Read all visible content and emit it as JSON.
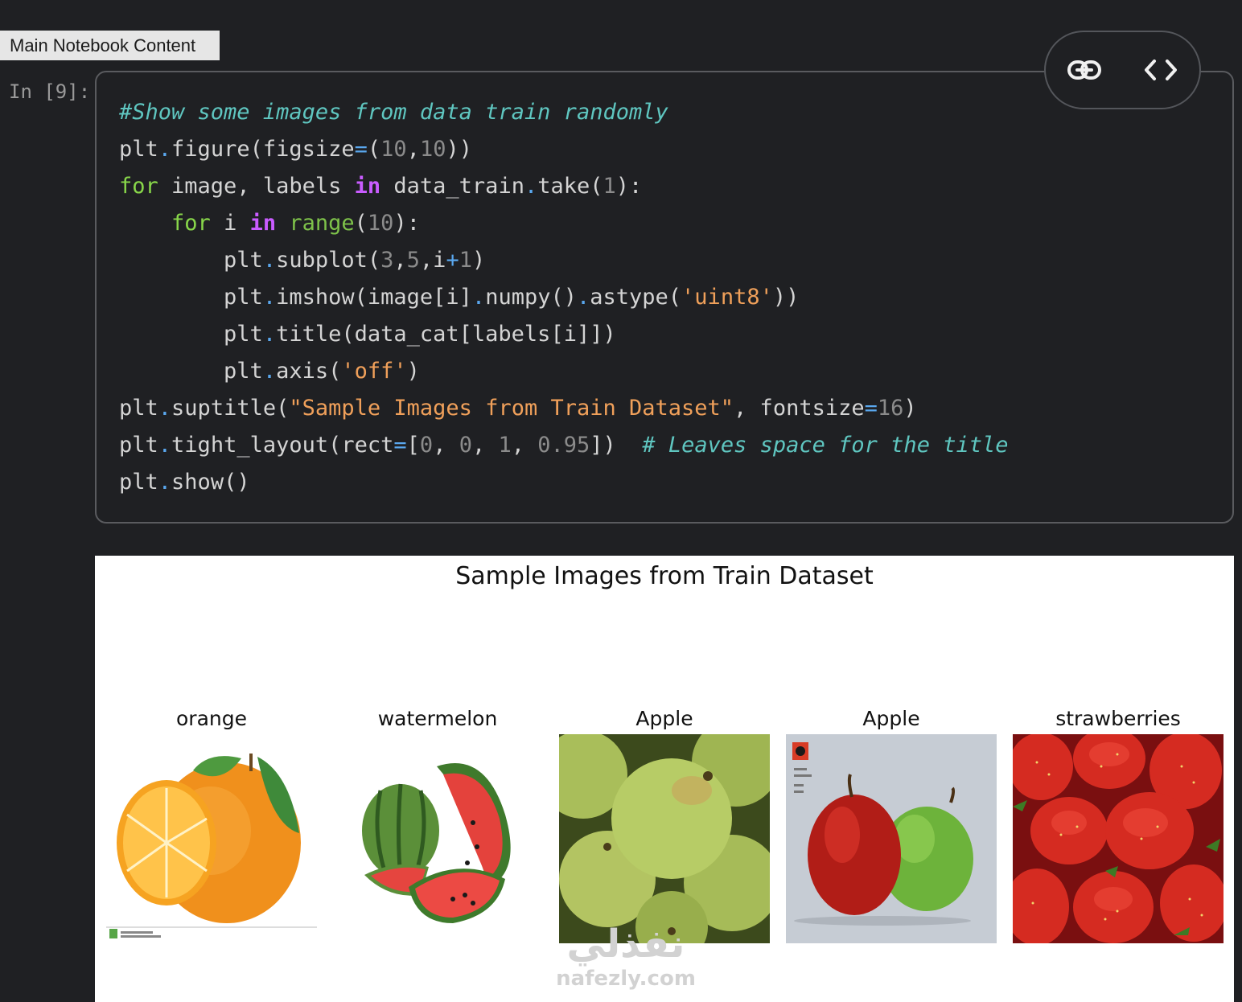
{
  "label": "Main Notebook Content",
  "cell": {
    "prompt": "In [9]:",
    "lines": [
      [
        [
          "cm",
          "#Show some images from data train randomly"
        ]
      ],
      [
        [
          "t",
          "plt"
        ],
        [
          "dot",
          "."
        ],
        [
          "t",
          "figure(figsize"
        ],
        [
          "eq",
          "="
        ],
        [
          "t",
          "("
        ],
        [
          "num",
          "10"
        ],
        [
          "t",
          ","
        ],
        [
          "num",
          "10"
        ],
        [
          "t",
          "))"
        ]
      ],
      [
        [
          "kw",
          "for"
        ],
        [
          "t",
          " image, labels "
        ],
        [
          "op",
          "in"
        ],
        [
          "t",
          " data_train"
        ],
        [
          "dot",
          "."
        ],
        [
          "t",
          "take("
        ],
        [
          "num",
          "1"
        ],
        [
          "t",
          "):"
        ]
      ],
      [
        [
          "t",
          "    "
        ],
        [
          "kw",
          "for"
        ],
        [
          "t",
          " i "
        ],
        [
          "op",
          "in"
        ],
        [
          "t",
          " "
        ],
        [
          "bi",
          "range"
        ],
        [
          "t",
          "("
        ],
        [
          "num",
          "10"
        ],
        [
          "t",
          "):"
        ]
      ],
      [
        [
          "t",
          "        plt"
        ],
        [
          "dot",
          "."
        ],
        [
          "t",
          "subplot("
        ],
        [
          "num",
          "3"
        ],
        [
          "t",
          ","
        ],
        [
          "num",
          "5"
        ],
        [
          "t",
          ",i"
        ],
        [
          "eq",
          "+"
        ],
        [
          "num",
          "1"
        ],
        [
          "t",
          ")"
        ]
      ],
      [
        [
          "t",
          "        plt"
        ],
        [
          "dot",
          "."
        ],
        [
          "t",
          "imshow(image[i]"
        ],
        [
          "dot",
          "."
        ],
        [
          "t",
          "numpy()"
        ],
        [
          "dot",
          "."
        ],
        [
          "t",
          "astype("
        ],
        [
          "str",
          "'uint8'"
        ],
        [
          "t",
          "))"
        ]
      ],
      [
        [
          "t",
          "        plt"
        ],
        [
          "dot",
          "."
        ],
        [
          "t",
          "title(data_cat[labels[i]])"
        ]
      ],
      [
        [
          "t",
          "        plt"
        ],
        [
          "dot",
          "."
        ],
        [
          "t",
          "axis("
        ],
        [
          "str",
          "'off'"
        ],
        [
          "t",
          ")"
        ]
      ],
      [
        [
          "t",
          "plt"
        ],
        [
          "dot",
          "."
        ],
        [
          "t",
          "suptitle("
        ],
        [
          "str",
          "\"Sample Images from Train Dataset\""
        ],
        [
          "t",
          ", fontsize"
        ],
        [
          "eq",
          "="
        ],
        [
          "num",
          "16"
        ],
        [
          "t",
          ")"
        ]
      ],
      [
        [
          "t",
          "plt"
        ],
        [
          "dot",
          "."
        ],
        [
          "t",
          "tight_layout(rect"
        ],
        [
          "eq",
          "="
        ],
        [
          "t",
          "["
        ],
        [
          "num",
          "0"
        ],
        [
          "t",
          ", "
        ],
        [
          "num",
          "0"
        ],
        [
          "t",
          ", "
        ],
        [
          "num",
          "1"
        ],
        [
          "t",
          ", "
        ],
        [
          "num",
          "0.95"
        ],
        [
          "t",
          "])  "
        ],
        [
          "cm",
          "# Leaves space for the title"
        ]
      ],
      [
        [
          "t",
          "plt"
        ],
        [
          "dot",
          "."
        ],
        [
          "t",
          "show()"
        ]
      ]
    ]
  },
  "toolbar": {
    "link_icon": "link-icon",
    "code_icon": "code-icon"
  },
  "output": {
    "suptitle": "Sample Images from Train Dataset",
    "images": [
      {
        "title": "orange",
        "kind": "orange"
      },
      {
        "title": "watermelon",
        "kind": "watermelon"
      },
      {
        "title": "Apple",
        "kind": "apples-green"
      },
      {
        "title": "Apple",
        "kind": "apples-pair"
      },
      {
        "title": "strawberries",
        "kind": "strawberries"
      }
    ],
    "watermark_ar": "نفذلي",
    "watermark_en": "nafezly.com"
  }
}
